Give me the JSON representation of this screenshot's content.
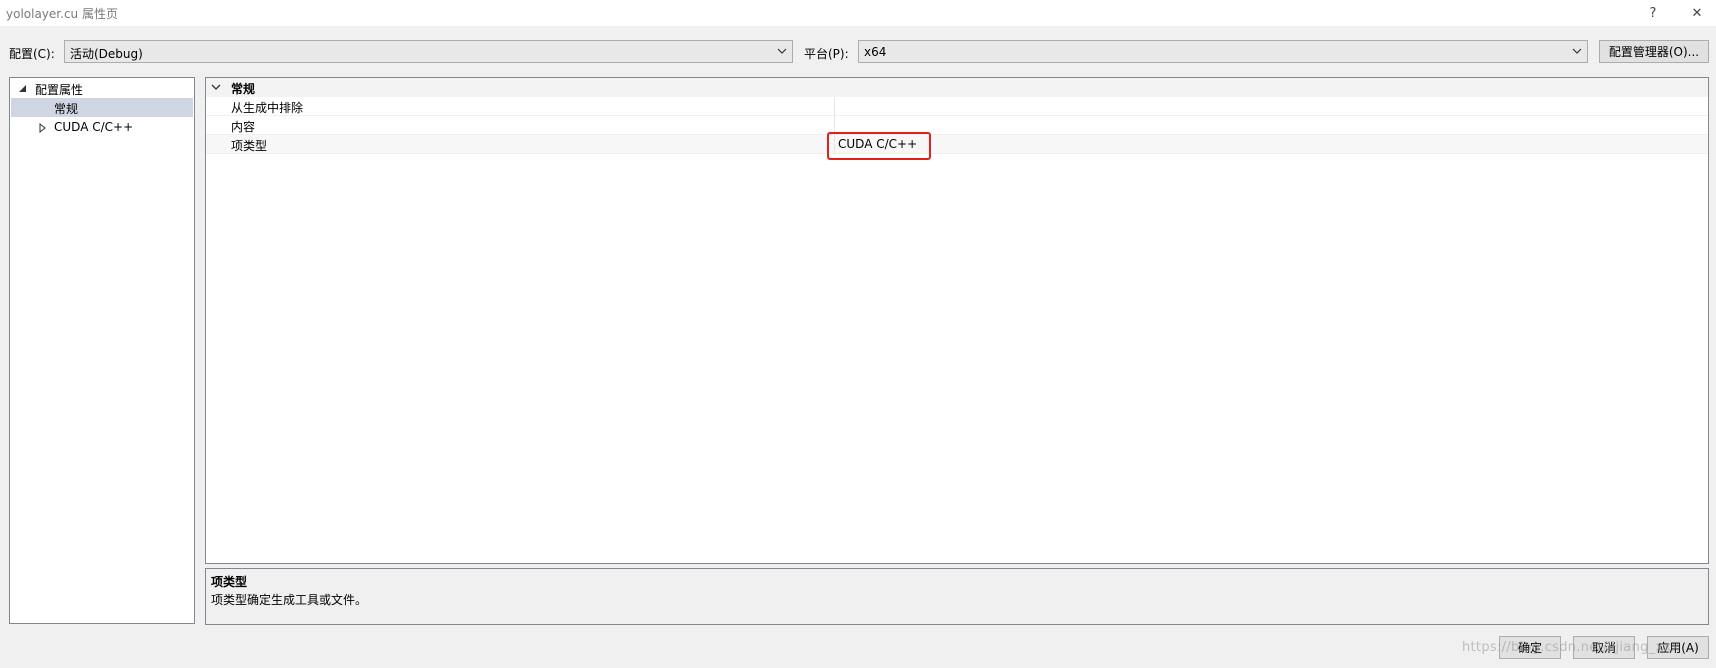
{
  "window": {
    "title": "yololayer.cu 属性页",
    "help_glyph": "?",
    "close_glyph": "✕"
  },
  "config_bar": {
    "config_label": "配置(C):",
    "config_value": "活动(Debug)",
    "platform_label": "平台(P):",
    "platform_value": "x64",
    "manager_button": "配置管理器(O)..."
  },
  "tree": {
    "root_label": "配置属性",
    "items": [
      {
        "label": "常规",
        "selected": true
      },
      {
        "label": "CUDA C/C++",
        "selected": false
      }
    ]
  },
  "property_grid": {
    "section_title": "常规",
    "rows": [
      {
        "name": "从生成中排除",
        "value": ""
      },
      {
        "name": "内容",
        "value": ""
      },
      {
        "name": "项类型",
        "value": "CUDA C/C++"
      }
    ]
  },
  "description": {
    "title": "项类型",
    "text": "项类型确定生成工具或文件。"
  },
  "buttons": {
    "ok": "确定",
    "cancel": "取消",
    "apply": "应用(A)"
  },
  "watermark": "https://blog.csdn.net/lijiang_xxx",
  "colors": {
    "highlight": "#e0201c",
    "selected_row": "#cfd6e3"
  }
}
